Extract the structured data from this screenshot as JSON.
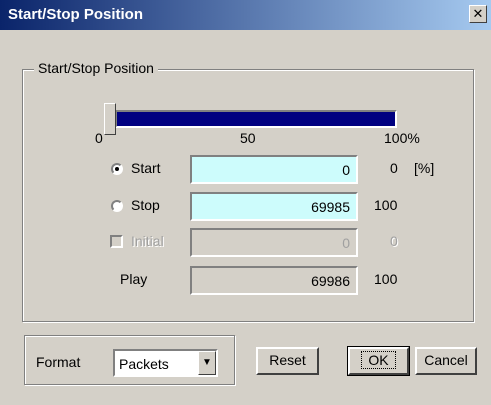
{
  "window": {
    "title": "Start/Stop Position",
    "close_glyph": "✕"
  },
  "group": {
    "label": "Start/Stop Position"
  },
  "slider": {
    "ticks": [
      "0",
      "50",
      "100%"
    ],
    "fill_fraction": 1.0,
    "track_color": "#000080"
  },
  "rows": {
    "start": {
      "label": "Start",
      "value": "0",
      "percent": "0",
      "unit": "[%]",
      "selected": true
    },
    "stop": {
      "label": "Stop",
      "value": "69985",
      "percent": "100",
      "selected": false
    },
    "initial": {
      "label": "Initial",
      "value": "0",
      "percent": "0",
      "enabled": false,
      "checked": false
    },
    "play": {
      "label": "Play",
      "value": "69986",
      "percent": "100"
    }
  },
  "format": {
    "label": "Format",
    "selected": "Packets"
  },
  "buttons": {
    "reset": "Reset",
    "ok": "OK",
    "cancel": "Cancel"
  },
  "colors": {
    "field_active": "#cdfcfc",
    "face": "#d4d0c8",
    "title_start": "#0a246a"
  }
}
